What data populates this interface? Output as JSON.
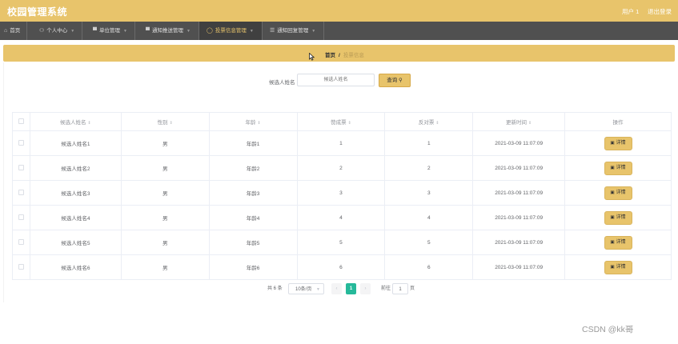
{
  "app": {
    "title": "校园管理系统",
    "user": "用户 1",
    "logout": "退出登录"
  },
  "nav": {
    "items": [
      {
        "label": "首页",
        "icon": "home-icon",
        "glyph": "⌂"
      },
      {
        "label": "个人中心",
        "icon": "user-icon",
        "glyph": "⚇"
      },
      {
        "label": "单位管理",
        "icon": "chat-icon",
        "glyph": "▀"
      },
      {
        "label": "通知推送管理",
        "icon": "notice-icon",
        "glyph": "▀"
      },
      {
        "label": "投票信息管理",
        "icon": "vote-icon",
        "glyph": "◯"
      },
      {
        "label": "通知回复管理",
        "icon": "list-icon",
        "glyph": "☰"
      }
    ],
    "active_index": 4
  },
  "breadcrumb": {
    "home": "首页",
    "sep": "/",
    "current": "投票信息"
  },
  "search": {
    "label": "候选人姓名",
    "placeholder": "候选人姓名",
    "button": "查询",
    "button_icon": "⚲"
  },
  "table": {
    "headers": [
      "候选人姓名",
      "性别",
      "年龄",
      "赞成票",
      "反对票",
      "更新时间",
      "操作"
    ],
    "rows": [
      {
        "name": "候选人姓名1",
        "gender": "男",
        "age": "年龄1",
        "yes": "1",
        "no": "1",
        "time": "2021-03-09 11:07:09"
      },
      {
        "name": "候选人姓名2",
        "gender": "男",
        "age": "年龄2",
        "yes": "2",
        "no": "2",
        "time": "2021-03-09 11:07:09"
      },
      {
        "name": "候选人姓名3",
        "gender": "男",
        "age": "年龄3",
        "yes": "3",
        "no": "3",
        "time": "2021-03-09 11:07:09"
      },
      {
        "name": "候选人姓名4",
        "gender": "男",
        "age": "年龄4",
        "yes": "4",
        "no": "4",
        "time": "2021-03-09 11:07:09"
      },
      {
        "name": "候选人姓名5",
        "gender": "男",
        "age": "年龄5",
        "yes": "5",
        "no": "5",
        "time": "2021-03-09 11:07:09"
      },
      {
        "name": "候选人姓名6",
        "gender": "男",
        "age": "年龄6",
        "yes": "6",
        "no": "6",
        "time": "2021-03-09 11:07:09"
      }
    ],
    "detail_label": "详情",
    "detail_icon": "▣",
    "sort_glyph": "⇕"
  },
  "pagination": {
    "total": "共 6 条",
    "size": "10条/页",
    "prev": "‹",
    "current": "1",
    "next": "›",
    "goto": "前往",
    "goto_value": "1",
    "page_suffix": "页"
  },
  "watermark": "CSDN @kk哥",
  "colors": {
    "accent": "#e8c46b",
    "nav_bg": "#505050",
    "page_active": "#26b99a"
  }
}
